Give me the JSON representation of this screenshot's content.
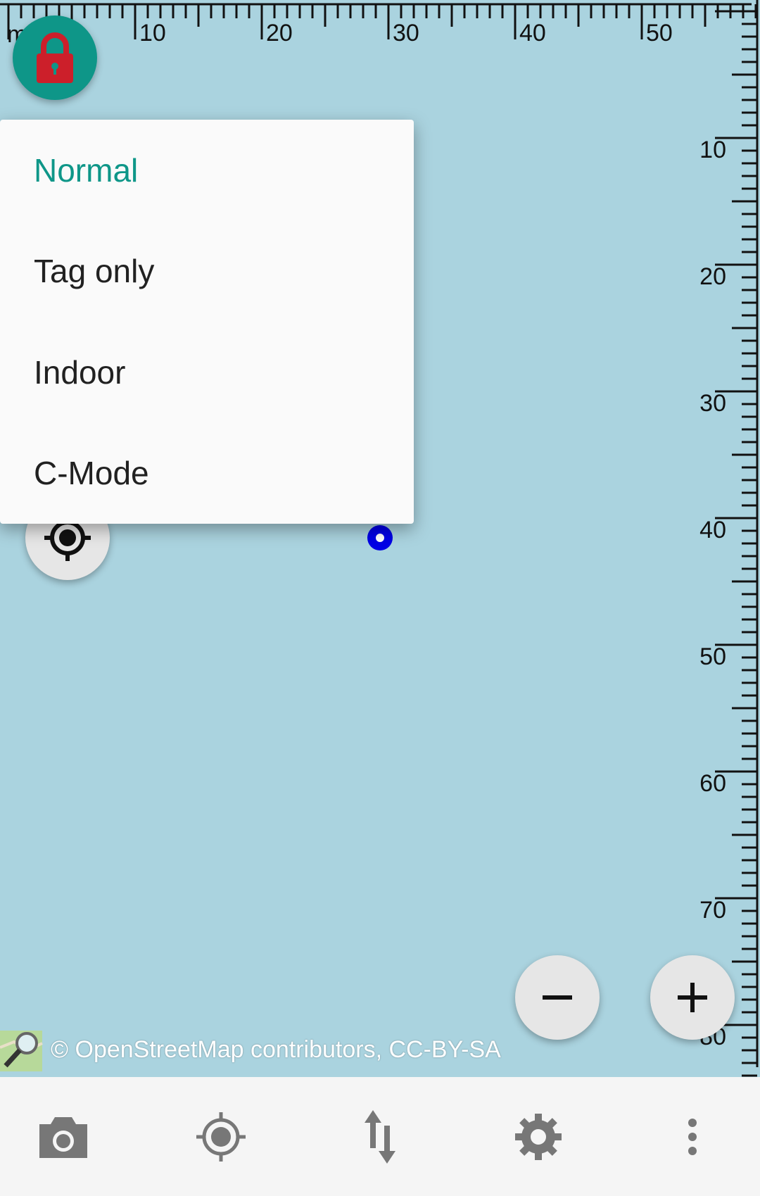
{
  "map": {
    "ruler": {
      "unit": "m",
      "top_labels": [
        "10",
        "20",
        "30",
        "40",
        "50"
      ],
      "right_labels": [
        "10",
        "20",
        "30",
        "40",
        "50",
        "60",
        "70",
        "80"
      ]
    },
    "attribution": "© OpenStreetMap contributors, CC-BY-SA"
  },
  "controls": {
    "lock_icon": "lock-icon",
    "locate_icon": "gps-crosshair-icon",
    "zoom_out_label": "−",
    "zoom_in_label": "+"
  },
  "menu": {
    "items": [
      {
        "label": "Normal",
        "selected": true
      },
      {
        "label": "Tag only",
        "selected": false
      },
      {
        "label": "Indoor",
        "selected": false
      },
      {
        "label": "C-Mode",
        "selected": false
      }
    ]
  },
  "bottom_bar": {
    "buttons": [
      {
        "icon": "camera-icon"
      },
      {
        "icon": "gps-icon"
      },
      {
        "icon": "transfer-icon"
      },
      {
        "icon": "settings-icon"
      },
      {
        "icon": "more-vert-icon"
      }
    ]
  },
  "colors": {
    "map_background": "#aad3df",
    "accent": "#0e9688",
    "lock_red": "#cc1f2a",
    "position_blue": "#0000e6"
  }
}
